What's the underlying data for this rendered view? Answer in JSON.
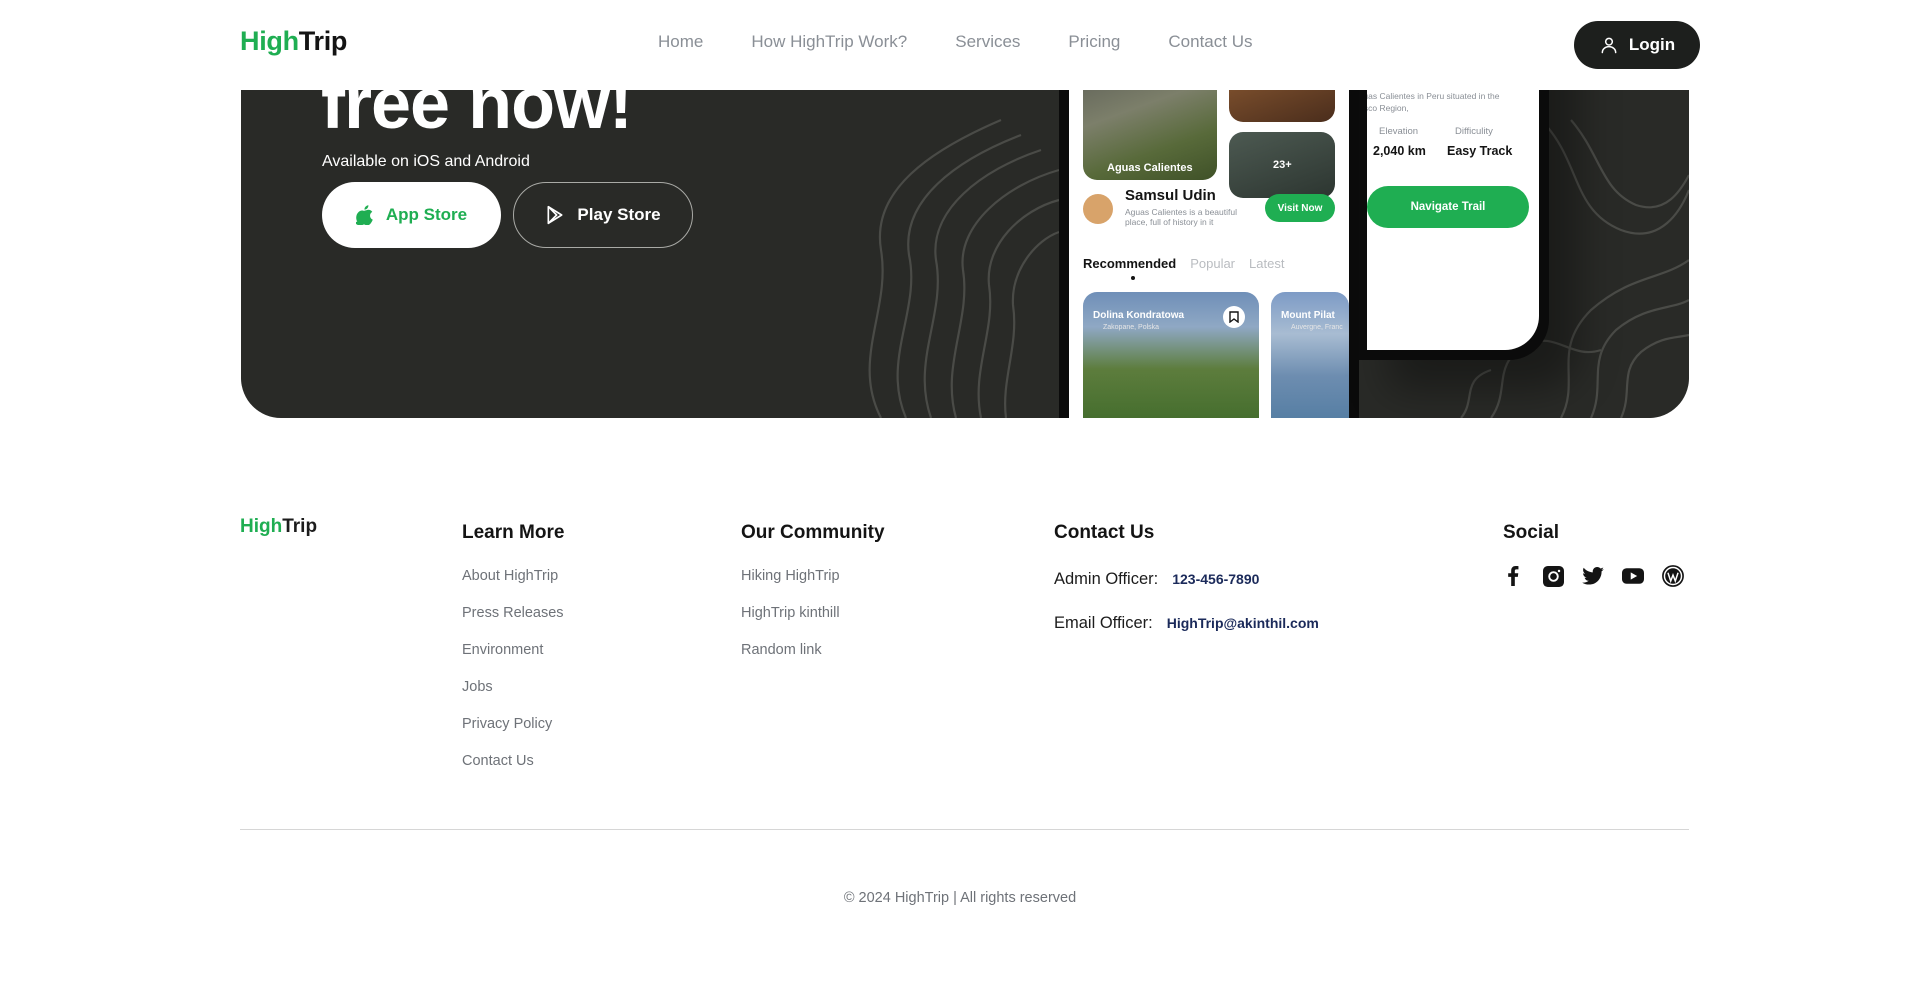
{
  "header": {
    "logo_green": "High",
    "logo_dark": "Trip",
    "nav": [
      "Home",
      "How HighTrip Work?",
      "Services",
      "Pricing",
      "Contact Us"
    ],
    "login_label": "Login"
  },
  "cta": {
    "headline": "free now!",
    "subtext": "Available on iOS and Android",
    "app_store_label": "App Store",
    "play_store_label": "Play Store"
  },
  "phone_main": {
    "thumb_label_1": "Aguas Calientes",
    "thumb_label_2": "23+",
    "person_name": "Samsul Udin",
    "person_desc": "Aguas Calientes is a beautiful place, full of history in it",
    "visit_button": "Visit Now",
    "tabs": [
      "Recommended",
      "Popular",
      "Latest"
    ],
    "card_1_title": "Dolina Kondratowa",
    "card_1_sub": "Zakopane, Polska",
    "card_2_title": "Mount Pilat",
    "card_2_sub": "Auvergne, Franc"
  },
  "phone_detail": {
    "description": "Machupicchu Pueblo, also known as Aguas Calientes in Peru situated in the Cusco Region,",
    "elevation_label": "Elevation",
    "elevation_value": "2,040 km",
    "difficulty_label": "Difficulity",
    "difficulty_value": "Easy Track",
    "navigate_button": "Navigate Trail"
  },
  "footer": {
    "logo_green": "High",
    "logo_dark": "Trip",
    "learn_more_title": "Learn More",
    "learn_more_links": [
      "About HighTrip",
      "Press Releases",
      "Environment",
      "Jobs",
      "Privacy Policy",
      "Contact Us"
    ],
    "community_title": "Our Community",
    "community_links": [
      "Hiking HighTrip",
      "HighTrip kinthill",
      "Random link"
    ],
    "contact_title": "Contact Us",
    "admin_label": "Admin Officer:",
    "admin_value": "123-456-7890",
    "email_label": "Email Officer:",
    "email_value": "HighTrip@akinthil.com",
    "social_title": "Social",
    "social_icons": [
      "facebook-icon",
      "instagram-icon",
      "twitter-icon",
      "youtube-icon",
      "wordpress-icon"
    ],
    "copyright": "© 2024 HighTrip | All rights reserved"
  },
  "colors": {
    "brand_green": "#1fae52",
    "cta_background": "#292a27",
    "login_background": "#1d1f1d",
    "contact_value": "#1b2a5a"
  }
}
